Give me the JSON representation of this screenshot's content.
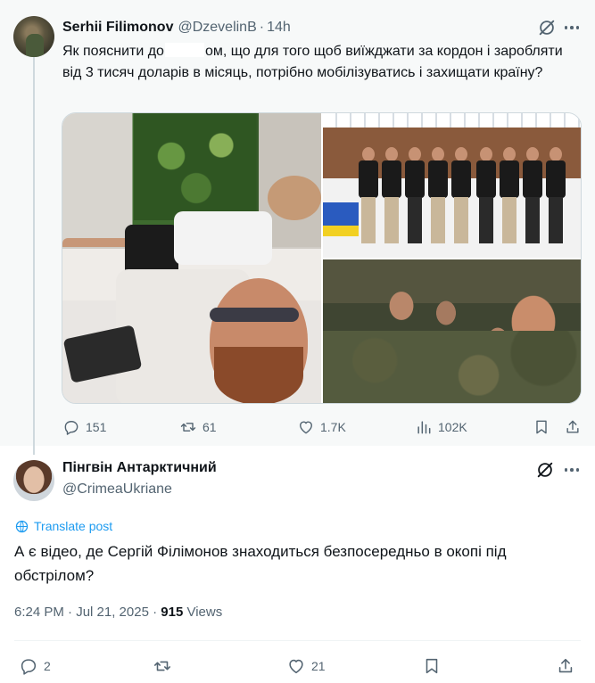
{
  "parent_tweet": {
    "author_name": "Serhii Filimonov",
    "author_handle": "@DzevelinB",
    "separator": "·",
    "time": "14h",
    "text_part1": "Як пояснити до",
    "text_part2": "ом, що для того щоб виїжджати за кордон і заробляти від 3 тисяч доларів в місяць, потрібно мобілізуватись і захищати країну?",
    "stats": {
      "replies": "151",
      "reposts": "61",
      "likes": "1.7K",
      "views": "102K"
    },
    "media_count": 3
  },
  "reply_tweet": {
    "author_name": "Пінгвін Антарктичний",
    "author_handle": "@CrimeaUkriane",
    "translate_label": "Translate post",
    "text": "А є відео, де Сергій Філімонов знаходиться безпосередньо в окопі під обстрілом?",
    "timestamp": "6:24 PM · Jul 21, 2025 · ",
    "views_count": "915",
    "views_label": " Views",
    "stats": {
      "replies": "2",
      "likes": "21"
    }
  },
  "colors": {
    "accent": "#1d9bf0",
    "secondary_text": "#536471",
    "primary_text": "#0f1419",
    "parent_bg": "#f7f9f9"
  },
  "icons": [
    "grok-icon",
    "more-icon",
    "reply-icon",
    "repost-icon",
    "like-icon",
    "views-icon",
    "bookmark-icon",
    "share-icon",
    "translate-icon"
  ]
}
